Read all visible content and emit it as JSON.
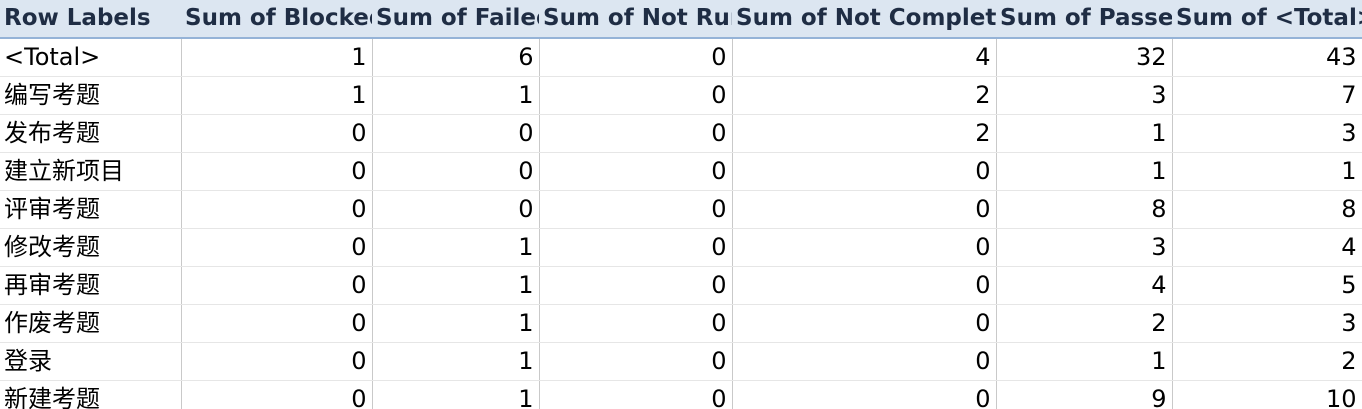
{
  "pivot": {
    "headers": [
      "Row Labels",
      "Sum of Blocked",
      "Sum of Failed",
      "Sum of Not Run",
      "Sum of Not Completed",
      "Sum of Passed",
      "Sum of <Total>"
    ],
    "rows": [
      {
        "label": "<Total>",
        "blocked": "1",
        "failed": "6",
        "not_run": "0",
        "not_completed": "4",
        "passed": "32",
        "total": "43"
      },
      {
        "label": "编写考题",
        "blocked": "1",
        "failed": "1",
        "not_run": "0",
        "not_completed": "2",
        "passed": "3",
        "total": "7"
      },
      {
        "label": "发布考题",
        "blocked": "0",
        "failed": "0",
        "not_run": "0",
        "not_completed": "2",
        "passed": "1",
        "total": "3"
      },
      {
        "label": "建立新项目",
        "blocked": "0",
        "failed": "0",
        "not_run": "0",
        "not_completed": "0",
        "passed": "1",
        "total": "1"
      },
      {
        "label": "评审考题",
        "blocked": "0",
        "failed": "0",
        "not_run": "0",
        "not_completed": "0",
        "passed": "8",
        "total": "8"
      },
      {
        "label": "修改考题",
        "blocked": "0",
        "failed": "1",
        "not_run": "0",
        "not_completed": "0",
        "passed": "3",
        "total": "4"
      },
      {
        "label": "再审考题",
        "blocked": "0",
        "failed": "1",
        "not_run": "0",
        "not_completed": "0",
        "passed": "4",
        "total": "5"
      },
      {
        "label": "作废考题",
        "blocked": "0",
        "failed": "1",
        "not_run": "0",
        "not_completed": "0",
        "passed": "2",
        "total": "3"
      },
      {
        "label": "登录",
        "blocked": "0",
        "failed": "1",
        "not_run": "0",
        "not_completed": "0",
        "passed": "1",
        "total": "2"
      },
      {
        "label": "新建考题",
        "blocked": "0",
        "failed": "1",
        "not_run": "0",
        "not_completed": "0",
        "passed": "9",
        "total": "10"
      }
    ]
  }
}
